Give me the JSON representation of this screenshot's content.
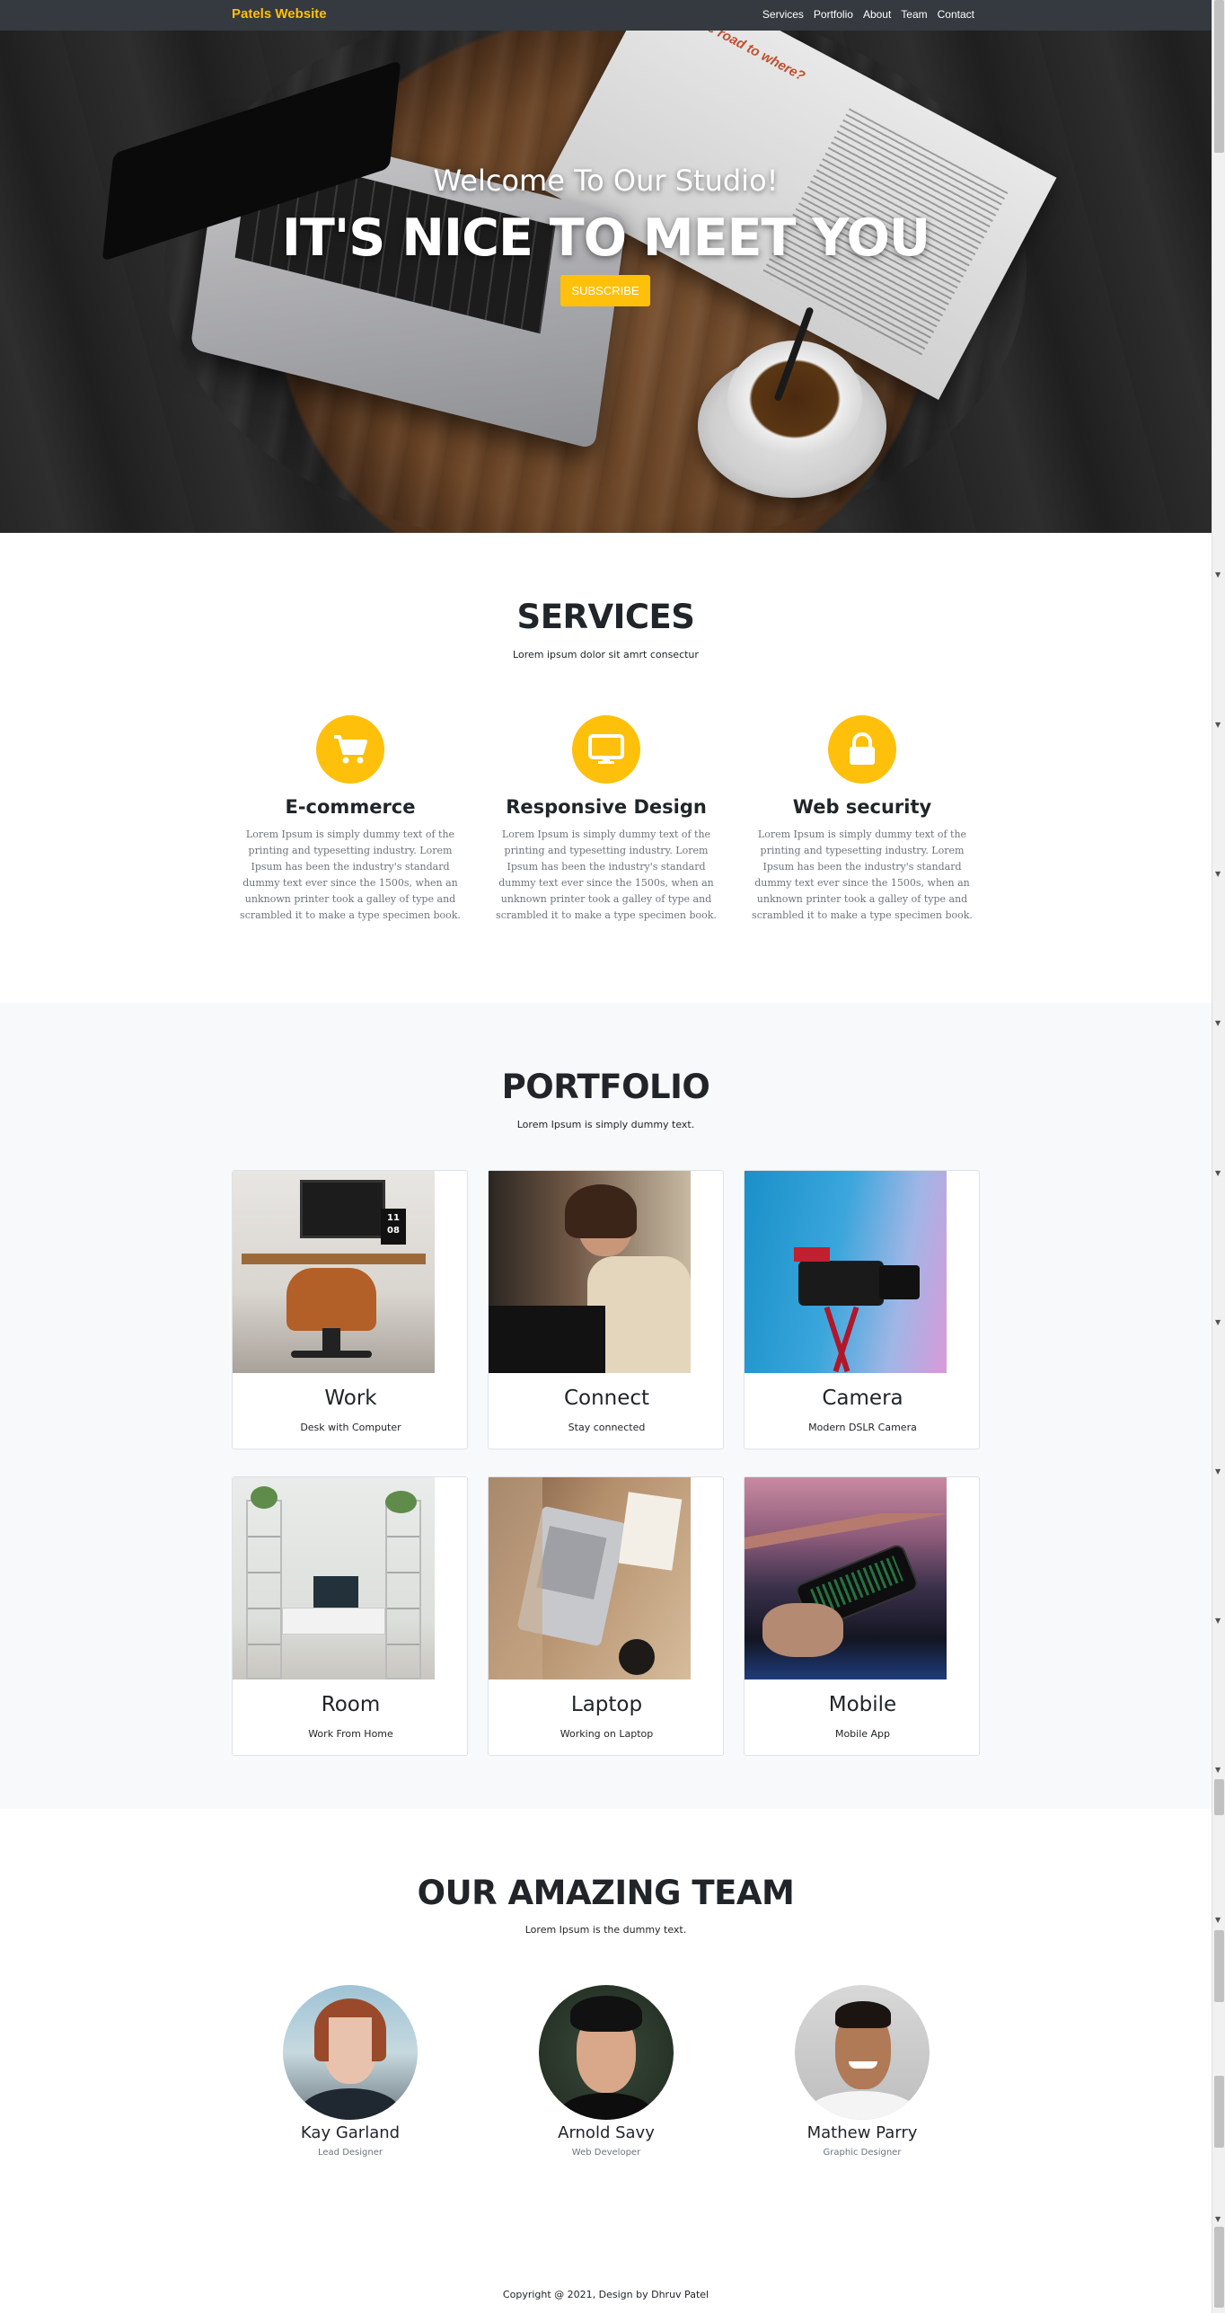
{
  "navbar": {
    "brand": "Patels Website",
    "links": [
      "Services",
      "Portfolio",
      "About",
      "Team",
      "Contact"
    ]
  },
  "hero": {
    "welcome": "Welcome To Our Studio!",
    "title": "IT'S NICE TO MEET YOU",
    "button": "SUBSCRIBE",
    "magazine_heading": "On the road to where?"
  },
  "services": {
    "title": "SERVICES",
    "subtitle": "Lorem ipsum dolor sit amrt consectur",
    "items": [
      {
        "icon": "cart-icon",
        "title": "E-commerce",
        "text": "Lorem Ipsum is simply dummy text of the printing and typesetting industry. Lorem Ipsum has been the industry's standard dummy text ever since the 1500s, when an unknown printer took a galley of type and scrambled it to make a type specimen book."
      },
      {
        "icon": "monitor-icon",
        "title": "Responsive Design",
        "text": "Lorem Ipsum is simply dummy text of the printing and typesetting industry. Lorem Ipsum has been the industry's standard dummy text ever since the 1500s, when an unknown printer took a galley of type and scrambled it to make a type specimen book."
      },
      {
        "icon": "lock-icon",
        "title": "Web security",
        "text": "Lorem Ipsum is simply dummy text of the printing and typesetting industry. Lorem Ipsum has been the industry's standard dummy text ever since the 1500s, when an unknown printer took a galley of type and scrambled it to make a type specimen book."
      }
    ]
  },
  "portfolio": {
    "title": "PORTFOLIO",
    "subtitle": "Lorem Ipsum is simply dummy text.",
    "items": [
      {
        "title": "Work",
        "subtitle": "Desk with Computer",
        "clock_text": "11 08"
      },
      {
        "title": "Connect",
        "subtitle": "Stay connected"
      },
      {
        "title": "Camera",
        "subtitle": "Modern DSLR Camera"
      },
      {
        "title": "Room",
        "subtitle": "Work From Home"
      },
      {
        "title": "Laptop",
        "subtitle": "Working on Laptop"
      },
      {
        "title": "Mobile",
        "subtitle": "Mobile App"
      }
    ]
  },
  "team": {
    "title": "OUR AMAZING TEAM",
    "subtitle": "Lorem Ipsum is the dummy text.",
    "members": [
      {
        "name": "Kay Garland",
        "role": "Lead Designer"
      },
      {
        "name": "Arnold Savy",
        "role": "Web Developer"
      },
      {
        "name": "Mathew Parry",
        "role": "Graphic Designer"
      }
    ]
  },
  "footer": {
    "copyright": "Copyright @ 2021, Design by Dhruv Patel"
  },
  "colors": {
    "accent": "#fec00b",
    "navbar": "#343a40",
    "portfolio_bg": "#f8f9fa"
  }
}
